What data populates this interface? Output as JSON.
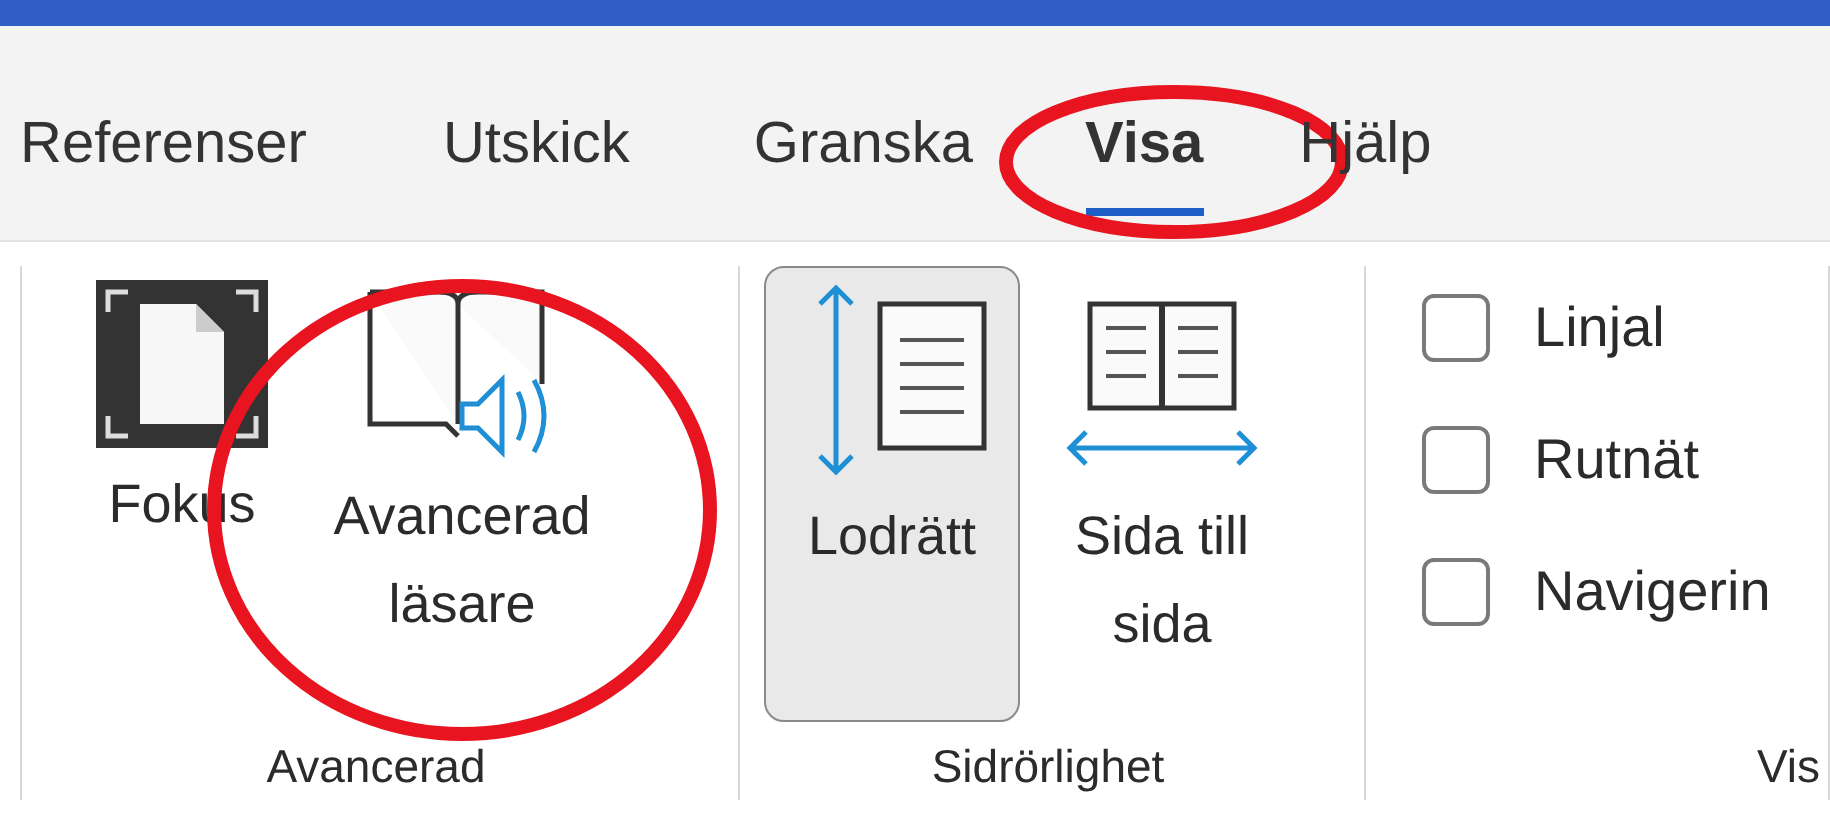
{
  "tabs": [
    {
      "label": "Referenser",
      "selected": false,
      "highlighted": false
    },
    {
      "label": "Utskick",
      "selected": false,
      "highlighted": false
    },
    {
      "label": "Granska",
      "selected": false,
      "highlighted": false
    },
    {
      "label": "Visa",
      "selected": true,
      "highlighted": true
    },
    {
      "label": "Hjälp",
      "selected": false,
      "highlighted": false
    }
  ],
  "groups": [
    {
      "label": "Avancerad",
      "items": [
        {
          "kind": "focus",
          "label": "Fokus",
          "selected": false,
          "highlighted": false
        },
        {
          "kind": "reader",
          "label": "Avancerad läsare",
          "selected": false,
          "highlighted": true
        }
      ]
    },
    {
      "label": "Sidrörlighet",
      "items": [
        {
          "kind": "vertical",
          "label": "Lodrätt",
          "selected": true,
          "highlighted": false
        },
        {
          "kind": "sidebyside",
          "label": "Sida till sida",
          "selected": false,
          "highlighted": false
        }
      ]
    },
    {
      "label": "Vis",
      "checkboxes": [
        {
          "label": "Linjal",
          "checked": false
        },
        {
          "label": "Rutnät",
          "checked": false
        },
        {
          "label": "Navigerin",
          "checked": false
        }
      ]
    }
  ]
}
